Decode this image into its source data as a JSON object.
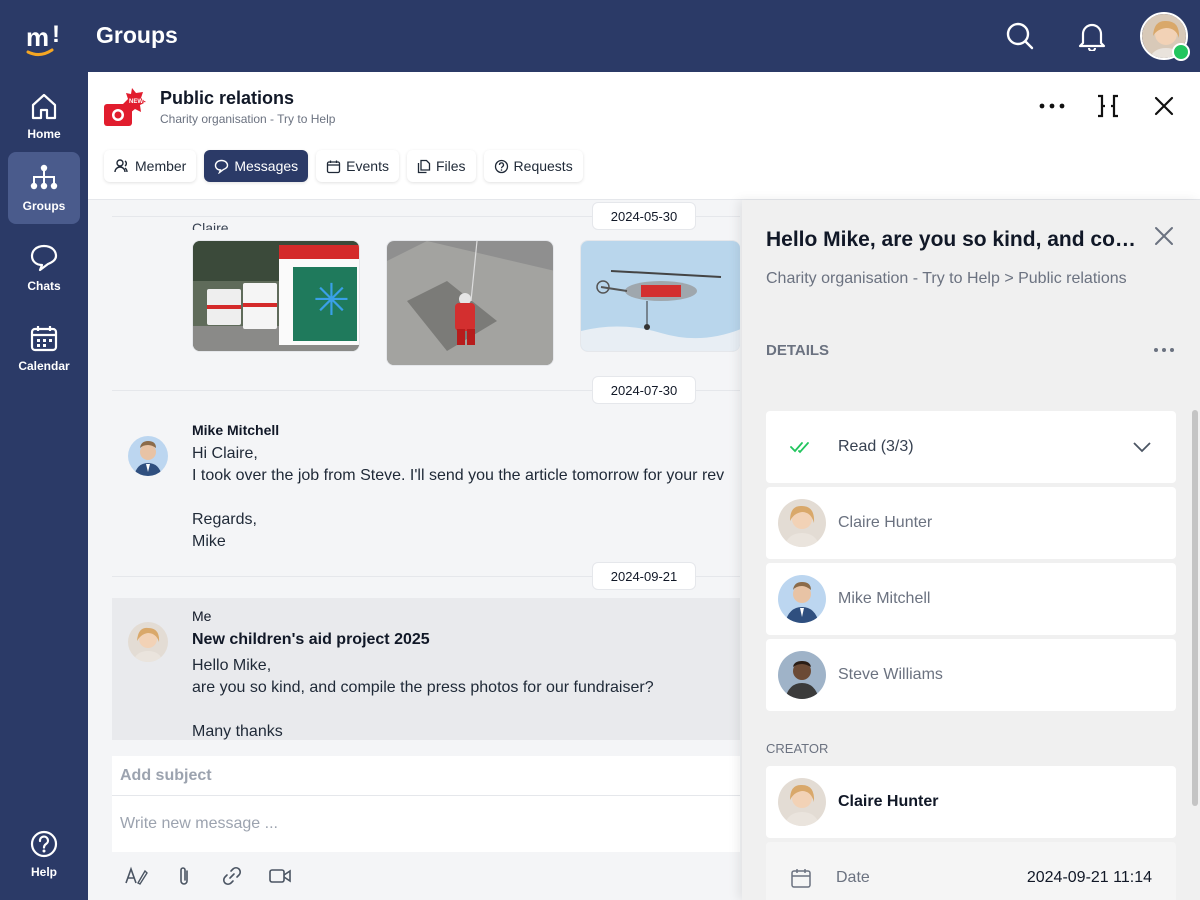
{
  "app": {
    "title": "Groups",
    "accent": "#2b3a67"
  },
  "topbar": {
    "icons": [
      "search-icon",
      "bell-icon"
    ],
    "avatar": "user-avatar"
  },
  "sidebar": {
    "items": [
      {
        "label": "Home",
        "icon": "home-icon"
      },
      {
        "label": "Groups",
        "icon": "groups-icon",
        "active": true
      },
      {
        "label": "Chats",
        "icon": "chat-icon"
      },
      {
        "label": "Calendar",
        "icon": "calendar-icon"
      },
      {
        "label": "Help",
        "icon": "help-icon"
      }
    ]
  },
  "group": {
    "title": "Public relations",
    "subtitle": "Charity organisation - Try to Help",
    "tabs": [
      {
        "label": "Member",
        "icon": "members-icon"
      },
      {
        "label": "Messages",
        "icon": "message-icon",
        "active": true
      },
      {
        "label": "Events",
        "icon": "calendar-icon"
      },
      {
        "label": "Files",
        "icon": "files-icon"
      },
      {
        "label": "Requests",
        "icon": "question-icon"
      }
    ]
  },
  "messages": {
    "dates": [
      "2024-05-30",
      "2024-07-30",
      "2024-09-21"
    ],
    "first_sender_fragment": "Claire",
    "thread": [
      {
        "sender": "Mike Mitchell",
        "lines": [
          "Hi Claire,",
          "I took over the job from Steve. I'll send you the article tomorrow for your rev",
          "",
          "Regards,",
          "Mike"
        ]
      },
      {
        "sender": "Me",
        "subject": "New children's aid project 2025",
        "lines": [
          "Hello Mike,",
          "are you so kind, and compile the press photos for our fundraiser?",
          "",
          "Many thanks"
        ]
      }
    ]
  },
  "composer": {
    "subject_placeholder": "Add subject",
    "body_placeholder": "Write new message ...",
    "tools": [
      "text-format-icon",
      "attachment-icon",
      "link-icon",
      "video-icon"
    ]
  },
  "panel": {
    "title": "Hello Mike, are you so kind, and compile the press photos for our fundraiser?",
    "breadcrumb": "Charity organisation - Try to Help > Public relations",
    "section": "DETAILS",
    "read_status": "Read (3/3)",
    "readers": [
      "Claire Hunter",
      "Mike Mitchell",
      "Steve Williams"
    ],
    "creator_label": "CREATOR",
    "creator": "Claire Hunter",
    "date_label": "Date",
    "date_value": "2024-09-21 11:14"
  }
}
